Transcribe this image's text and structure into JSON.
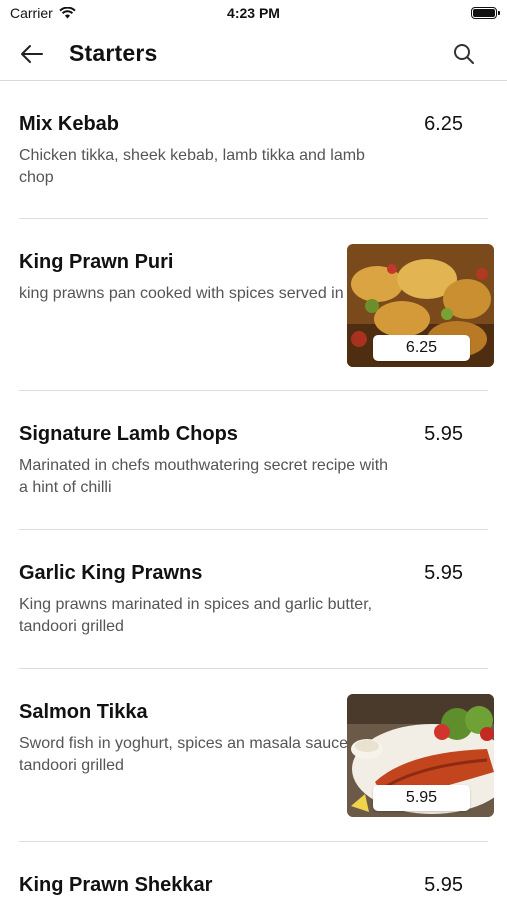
{
  "status": {
    "carrier": "Carrier",
    "time": "4:23 PM"
  },
  "header": {
    "title": "Starters"
  },
  "items": [
    {
      "name": "Mix Kebab",
      "description": "Chicken tikka, sheek kebab, lamb tikka and lamb chop",
      "price": "6.25"
    },
    {
      "name": "King Prawn Puri",
      "description": "king prawns pan cooked with spices served in a puri",
      "price": "6.25"
    },
    {
      "name": "Signature Lamb Chops",
      "description": "Marinated in chefs mouthwatering secret recipe with a hint of chilli",
      "price": "5.95"
    },
    {
      "name": "Garlic King Prawns",
      "description": "King prawns marinated in spices and garlic butter, tandoori grilled",
      "price": "5.95"
    },
    {
      "name": "Salmon Tikka",
      "description": "Sword fish in yoghurt, spices an masala sauce then tandoori grilled",
      "price": "5.95"
    },
    {
      "name": "King Prawn Shekkar",
      "description": "",
      "price": "5.95"
    }
  ]
}
